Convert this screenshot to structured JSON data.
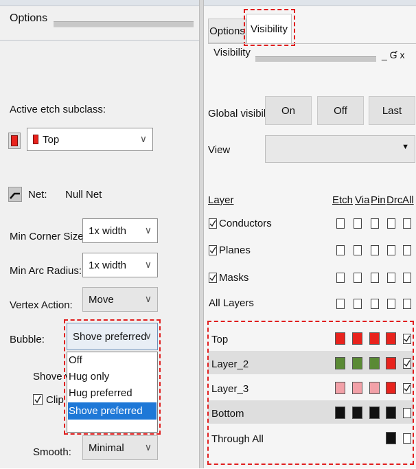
{
  "left": {
    "title": "Options",
    "active_etch_label": "Active etch subclass:",
    "active_etch_value": "Top",
    "net_label": "Net:",
    "net_value": "Null Net",
    "min_corner_label": "Min Corner Size:",
    "min_corner_value": "1x width",
    "min_arc_label": "Min Arc Radius:",
    "min_arc_value": "1x width",
    "vertex_label": "Vertex Action:",
    "vertex_value": "Move",
    "bubble_label": "Bubble:",
    "bubble_value": "Shove preferred",
    "bubble_options": [
      "Off",
      "Hug only",
      "Hug preferred",
      "Shove preferred"
    ],
    "shove_partial": "Shove v",
    "clip_partial": "Clip d",
    "smooth_label": "Smooth:",
    "smooth_value": "Minimal",
    "colors": {
      "top_red": "#e8231d",
      "selection_blue": "#1e78d7"
    }
  },
  "right": {
    "tabs": [
      "Options",
      "Visibility"
    ],
    "active_tab": "Visibility",
    "panel_title": "Visibility",
    "title_controls": "_ Ɠ x",
    "global_visibility_label": "Global visibility",
    "buttons": {
      "on": "On",
      "off": "Off",
      "last": "Last"
    },
    "view_label": "View",
    "view_value": "",
    "columns": {
      "layer": "Layer",
      "etch": "Etch",
      "via": "Via",
      "pin": "Pin",
      "drc": "Drc",
      "all": "All"
    },
    "groups": [
      {
        "name": "Conductors",
        "checked": true
      },
      {
        "name": "Planes",
        "checked": true
      },
      {
        "name": "Masks",
        "checked": true
      },
      {
        "name": "All Layers",
        "checked": false
      }
    ],
    "layers": [
      {
        "name": "Top",
        "etch": "#e8231d",
        "via": "#e8231d",
        "pin": "#e8231d",
        "drc": "#e8231d",
        "all_checked": true
      },
      {
        "name": "Layer_2",
        "etch": "#5a8a35",
        "via": "#5a8a35",
        "pin": "#5a8a35",
        "drc": "#e8231d",
        "all_checked": true
      },
      {
        "name": "Layer_3",
        "etch": "#f2a1a8",
        "via": "#f2a1a8",
        "pin": "#f2a1a8",
        "drc": "#e8231d",
        "all_checked": true
      },
      {
        "name": "Bottom",
        "etch": "#111111",
        "via": "#111111",
        "pin": "#111111",
        "drc": "#111111",
        "all_checked": false
      },
      {
        "name": "Through All",
        "drc": "#111111",
        "all_checked": false
      }
    ]
  }
}
